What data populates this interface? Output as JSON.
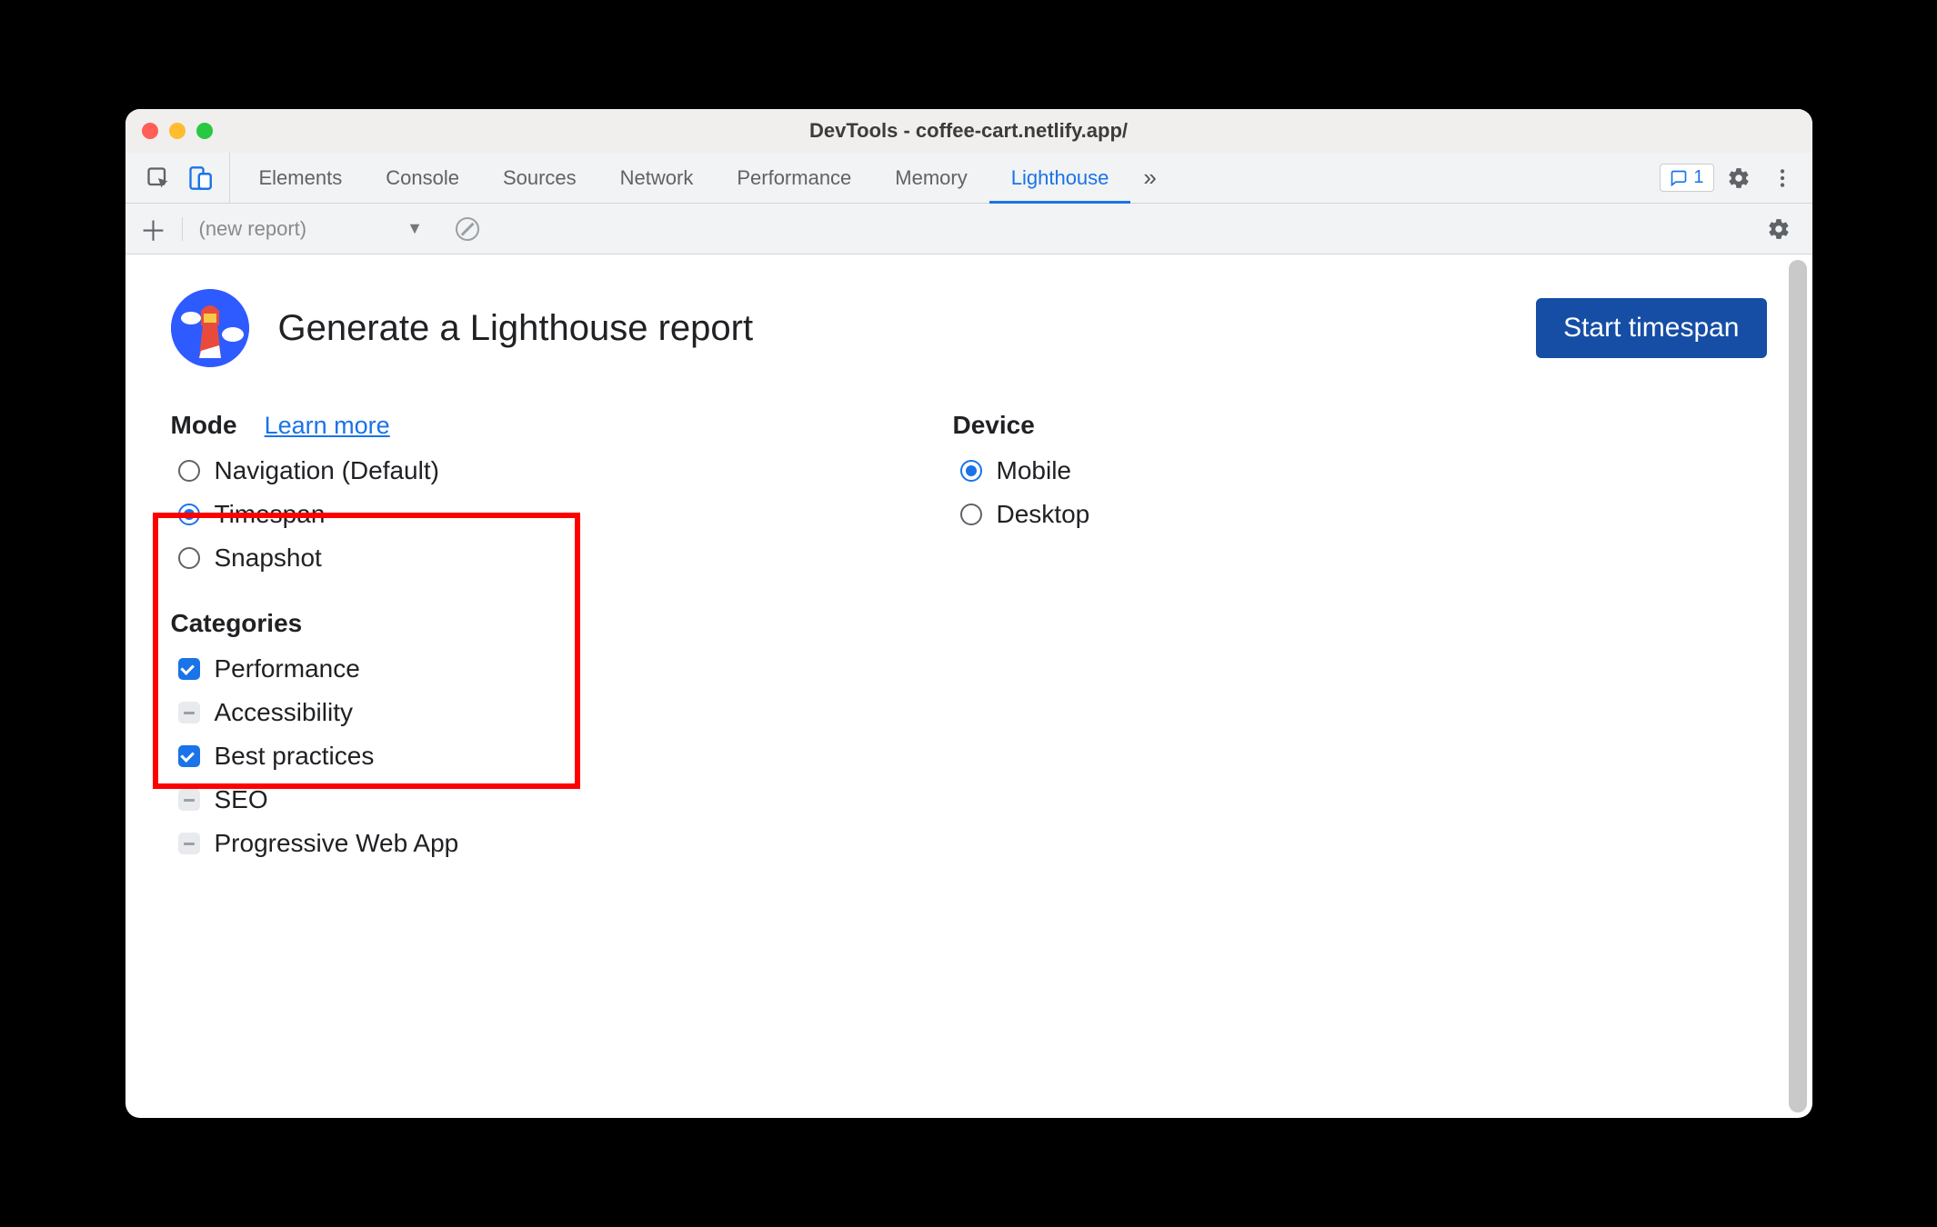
{
  "window": {
    "title": "DevTools - coffee-cart.netlify.app/"
  },
  "tabs": {
    "items": [
      "Elements",
      "Console",
      "Sources",
      "Network",
      "Performance",
      "Memory",
      "Lighthouse"
    ],
    "active": "Lighthouse",
    "overflow_glyph": "»"
  },
  "issues_badge": {
    "count": "1"
  },
  "subbar": {
    "new_report_label": "(new report)"
  },
  "header": {
    "title": "Generate a Lighthouse report",
    "action_label": "Start timespan"
  },
  "mode": {
    "label": "Mode",
    "learn_more": "Learn more",
    "options": [
      {
        "label": "Navigation (Default)",
        "checked": false
      },
      {
        "label": "Timespan",
        "checked": true
      },
      {
        "label": "Snapshot",
        "checked": false
      }
    ]
  },
  "device": {
    "label": "Device",
    "options": [
      {
        "label": "Mobile",
        "checked": true
      },
      {
        "label": "Desktop",
        "checked": false
      }
    ]
  },
  "categories": {
    "label": "Categories",
    "items": [
      {
        "label": "Performance",
        "state": "checked"
      },
      {
        "label": "Accessibility",
        "state": "indeterminate"
      },
      {
        "label": "Best practices",
        "state": "checked"
      },
      {
        "label": "SEO",
        "state": "indeterminate"
      },
      {
        "label": "Progressive Web App",
        "state": "indeterminate"
      }
    ]
  },
  "highlight": {
    "target": "mode-section"
  }
}
